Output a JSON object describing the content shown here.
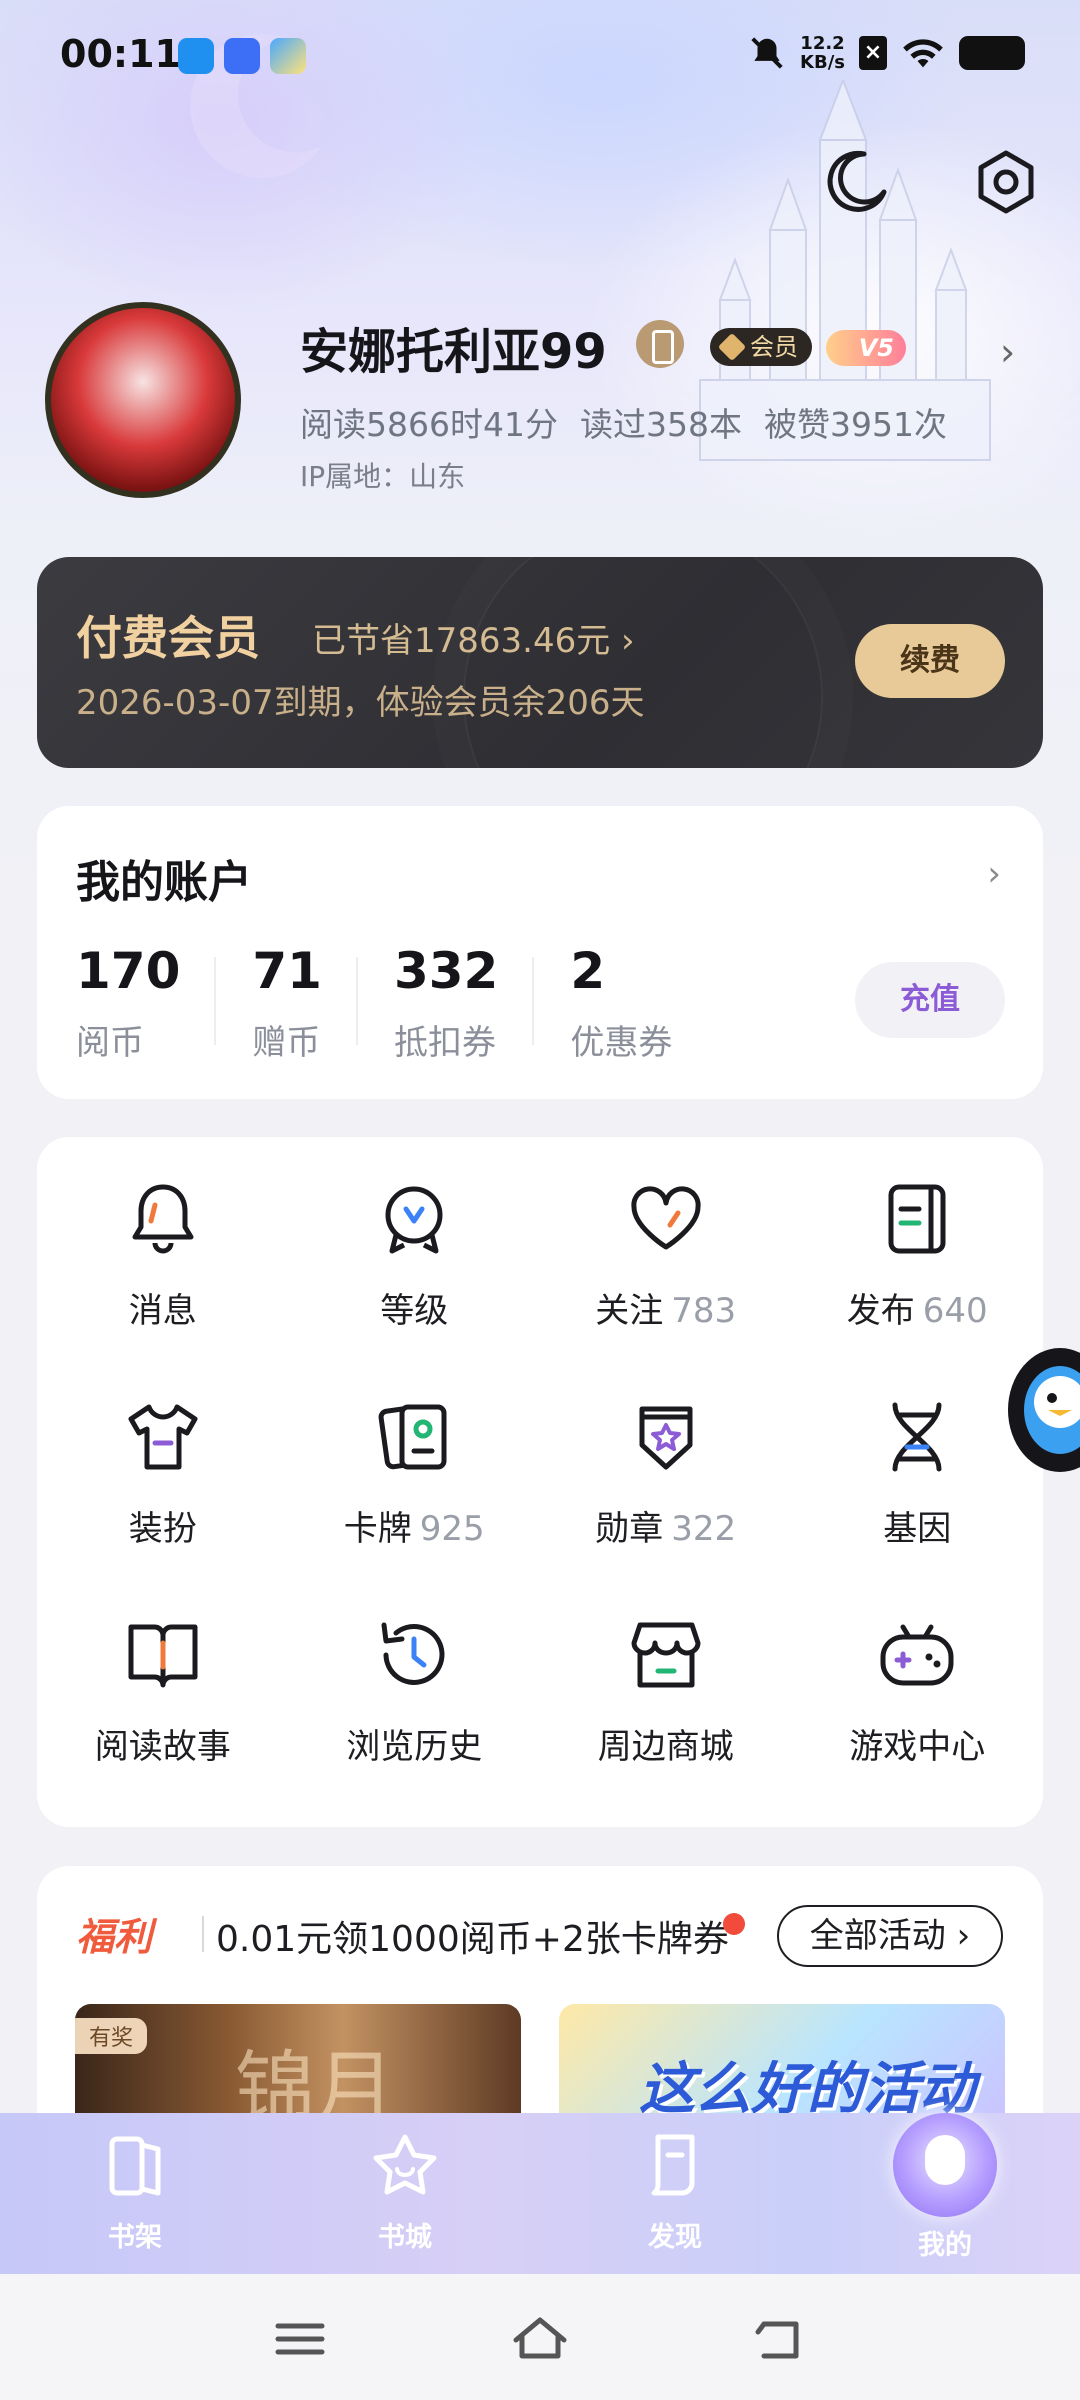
{
  "status_bar": {
    "time": "00:11",
    "net_speed_value": "12.2",
    "net_speed_unit": "KB/s",
    "icons": [
      "qq-icon",
      "browser-icon",
      "app-icon",
      "mute-icon",
      "sim-icon",
      "wifi-icon",
      "battery-icon"
    ]
  },
  "top_actions": {
    "icons": [
      "night-mode-icon",
      "settings-icon"
    ]
  },
  "profile": {
    "username": "安娜托利亚99",
    "member_badge": "会员",
    "vip_level": "V5",
    "stats": {
      "read_time": "阅读5866时41分",
      "books_read": "读过358本",
      "likes": "被赞3951次"
    },
    "ip_location": "IP属地：山东"
  },
  "member_card": {
    "title": "付费会员",
    "saved": "已节省17863.46元 ›",
    "expire": "2026-03-07到期，体验会员余206天",
    "renew_label": "续费"
  },
  "account": {
    "title": "我的账户",
    "stats": [
      {
        "value": "170",
        "label": "阅币"
      },
      {
        "value": "71",
        "label": "赠币"
      },
      {
        "value": "332",
        "label": "抵扣券"
      },
      {
        "value": "2",
        "label": "优惠券"
      }
    ],
    "recharge_label": "充值"
  },
  "features": [
    {
      "label": "消息",
      "count": "",
      "icon": "bell-icon"
    },
    {
      "label": "等级",
      "count": "",
      "icon": "level-icon"
    },
    {
      "label": "关注",
      "count": "783",
      "icon": "heart-icon"
    },
    {
      "label": "发布",
      "count": "640",
      "icon": "publish-icon"
    },
    {
      "label": "装扮",
      "count": "",
      "icon": "outfit-icon"
    },
    {
      "label": "卡牌",
      "count": "925",
      "icon": "cards-icon"
    },
    {
      "label": "勋章",
      "count": "322",
      "icon": "medal-icon"
    },
    {
      "label": "基因",
      "count": "",
      "icon": "dna-icon"
    },
    {
      "label": "阅读故事",
      "count": "",
      "icon": "book-icon"
    },
    {
      "label": "浏览历史",
      "count": "",
      "icon": "history-icon"
    },
    {
      "label": "周边商城",
      "count": "",
      "icon": "shop-icon"
    },
    {
      "label": "游戏中心",
      "count": "",
      "icon": "gamepad-icon"
    }
  ],
  "welfare": {
    "title": "福利",
    "promo": "0.01元领1000阅币+2张卡牌券",
    "all_activities": "全部活动 ›",
    "banner_left_tag": "有奖",
    "banner_left_text": "锦月",
    "banner_right_text": "这么好的活动"
  },
  "tab_bar": {
    "tabs": [
      {
        "label": "书架",
        "icon": "bookshelf-icon"
      },
      {
        "label": "书城",
        "icon": "bookstore-icon"
      },
      {
        "label": "发现",
        "icon": "discover-icon"
      },
      {
        "label": "我的",
        "icon": "me-icon"
      }
    ],
    "active": "我的"
  },
  "system_nav": {
    "icons": [
      "menu-icon",
      "home-icon",
      "back-icon"
    ]
  },
  "colors": {
    "accent_gold": "#e8c998",
    "member_card_bg": "#2e2e33",
    "recharge_purple": "#8b5cd6",
    "welfare_red": "#f05b3e"
  }
}
